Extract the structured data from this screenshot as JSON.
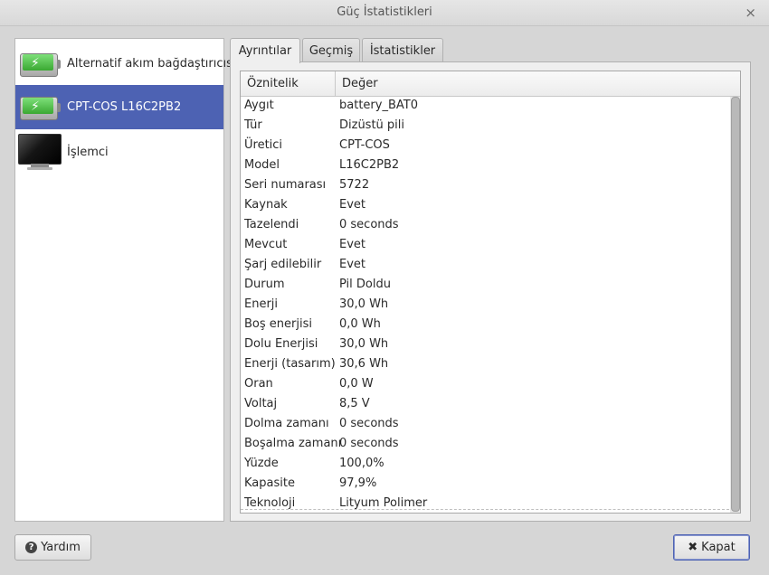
{
  "window": {
    "title": "Güç İstatistikleri",
    "close_glyph": "×"
  },
  "devices": [
    {
      "label": "Alternatif akım bağdaştırıcısı",
      "icon": "battery-icon",
      "selected": false
    },
    {
      "label": "CPT-COS L16C2PB2",
      "icon": "battery-icon",
      "selected": true
    },
    {
      "label": "İşlemci",
      "icon": "monitor-icon",
      "selected": false
    }
  ],
  "tabs": [
    {
      "label": "Ayrıntılar",
      "active": true
    },
    {
      "label": "Geçmiş",
      "active": false
    },
    {
      "label": "İstatistikler",
      "active": false
    }
  ],
  "table": {
    "headers": {
      "attribute": "Öznitelik",
      "value": "Değer"
    },
    "rows": [
      {
        "attr": "Aygıt",
        "value": "battery_BAT0"
      },
      {
        "attr": "Tür",
        "value": "Dizüstü pili"
      },
      {
        "attr": "Üretici",
        "value": "CPT-COS"
      },
      {
        "attr": "Model",
        "value": "L16C2PB2"
      },
      {
        "attr": "Seri numarası",
        "value": "5722"
      },
      {
        "attr": "Kaynak",
        "value": "Evet"
      },
      {
        "attr": "Tazelendi",
        "value": "0 seconds"
      },
      {
        "attr": "Mevcut",
        "value": "Evet"
      },
      {
        "attr": "Şarj edilebilir",
        "value": "Evet"
      },
      {
        "attr": "Durum",
        "value": "Pil Doldu"
      },
      {
        "attr": "Enerji",
        "value": "30,0 Wh"
      },
      {
        "attr": "Boş enerjisi",
        "value": "0,0 Wh"
      },
      {
        "attr": "Dolu Enerjisi",
        "value": "30,0 Wh"
      },
      {
        "attr": "Enerji (tasarım)",
        "value": "30,6 Wh"
      },
      {
        "attr": "Oran",
        "value": "0,0 W"
      },
      {
        "attr": "Voltaj",
        "value": "8,5 V"
      },
      {
        "attr": "Dolma zamanı",
        "value": "0 seconds"
      },
      {
        "attr": "Boşalma zamanı",
        "value": "0 seconds"
      },
      {
        "attr": "Yüzde",
        "value": "100,0%"
      },
      {
        "attr": "Kapasite",
        "value": "97,9%"
      },
      {
        "attr": "Teknoloji",
        "value": "Lityum Polimer"
      }
    ]
  },
  "buttons": {
    "help": "Yardım",
    "close": "Kapat",
    "help_glyph": "?",
    "close_glyph": "✖"
  },
  "colors": {
    "selection": "#4d62b3",
    "battery_fill": "#3aa832"
  }
}
